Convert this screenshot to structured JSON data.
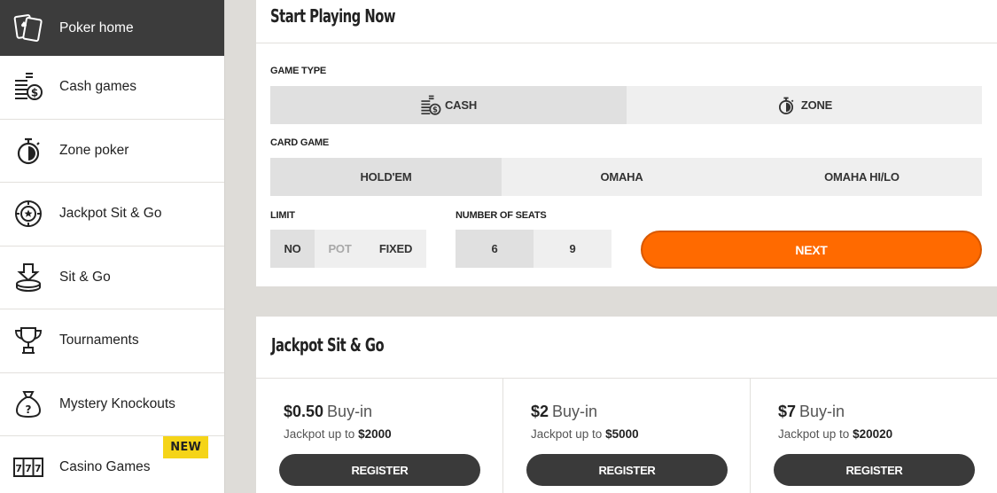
{
  "sidebar": {
    "items": [
      {
        "label": "Poker home",
        "icon": "cards-icon",
        "active": true
      },
      {
        "label": "Cash games",
        "icon": "coins-icon"
      },
      {
        "label": "Zone poker",
        "icon": "stopwatch-icon"
      },
      {
        "label": "Jackpot Sit & Go",
        "icon": "poker-chip-icon"
      },
      {
        "label": "Sit & Go",
        "icon": "chip-drop-icon"
      },
      {
        "label": "Tournaments",
        "icon": "trophy-icon"
      },
      {
        "label": "Mystery Knockouts",
        "icon": "mystery-bag-icon"
      },
      {
        "label": "Casino Games",
        "icon": "slot-777-icon",
        "badge": "NEW"
      }
    ]
  },
  "start": {
    "title": "Start Playing Now",
    "game_type_label": "GAME TYPE",
    "game_types": [
      "CASH",
      "ZONE"
    ],
    "card_game_label": "CARD GAME",
    "card_games": [
      "HOLD'EM",
      "OMAHA",
      "OMAHA HI/LO"
    ],
    "limit_label": "LIMIT",
    "limits": [
      "NO",
      "POT",
      "FIXED"
    ],
    "seats_label": "NUMBER OF SEATS",
    "seats": [
      "6",
      "9"
    ],
    "next": "NEXT"
  },
  "jackpot": {
    "title": "Jackpot Sit & Go",
    "buyin_word": "Buy-in",
    "jackpot_prefix": "Jackpot up to",
    "register": "REGISTER",
    "cards": [
      {
        "buyin": "$0.50",
        "jackpot": "$2000"
      },
      {
        "buyin": "$2",
        "jackpot": "$5000"
      },
      {
        "buyin": "$7",
        "jackpot": "$20020"
      }
    ]
  },
  "colors": {
    "accent": "#ff6a00",
    "sidebar_active": "#3c3c3c",
    "badge": "#f5d418"
  }
}
